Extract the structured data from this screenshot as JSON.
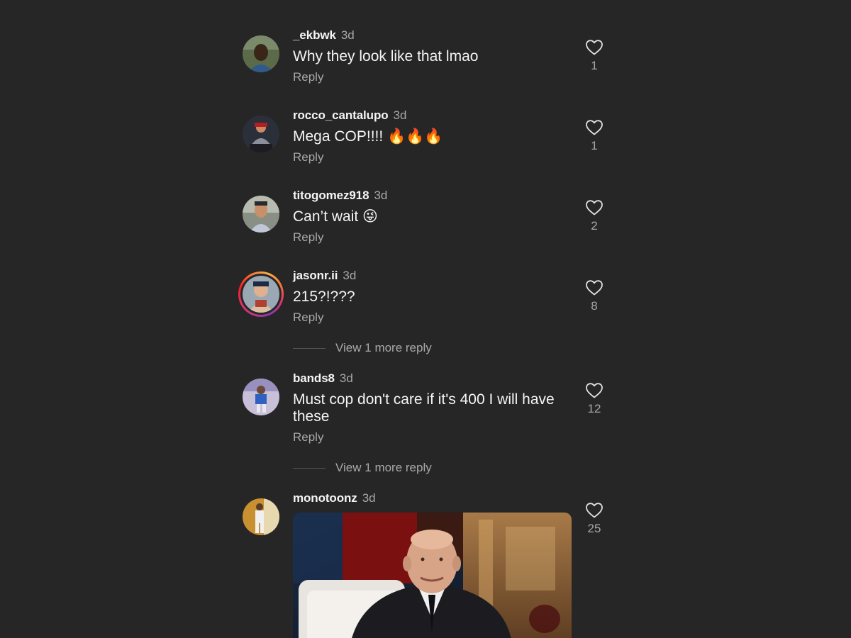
{
  "comments": [
    {
      "username": "_ekbwk",
      "time": "3d",
      "text": "Why they look like that lmao",
      "reply": "Reply",
      "likes": "1"
    },
    {
      "username": "rocco_cantalupo",
      "time": "3d",
      "text": "Mega COP!!!! 🔥🔥🔥",
      "reply": "Reply",
      "likes": "1"
    },
    {
      "username": "titogomez918",
      "time": "3d",
      "text": "Can’t wait 😜",
      "reply": "Reply",
      "likes": "2"
    },
    {
      "username": "jasonr.ii",
      "time": "3d",
      "text": "215?!???",
      "reply": "Reply",
      "likes": "8",
      "view_more": "View 1 more reply"
    },
    {
      "username": "bands8",
      "time": "3d",
      "text": "Must cop don't care if it's 400 I will have these",
      "reply": "Reply",
      "likes": "12",
      "view_more": "View 1 more reply"
    },
    {
      "username": "monotoonz",
      "time": "3d",
      "likes": "25"
    }
  ],
  "icons": {
    "like": "heart-outline-icon"
  },
  "colors": {
    "background": "#262626",
    "text": "#f5f5f5",
    "muted": "#a8a8a8"
  }
}
